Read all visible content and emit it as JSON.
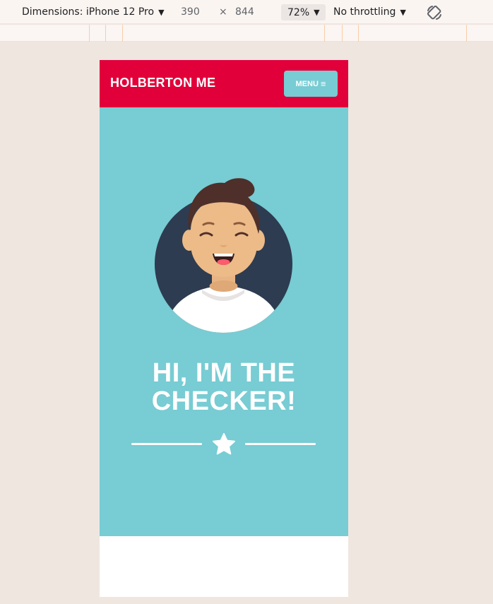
{
  "devtools": {
    "dimensions_label": "Dimensions: iPhone 12 Pro",
    "width": "390",
    "times": "×",
    "height": "844",
    "zoom": "72%",
    "throttling": "No throttling",
    "caret": "▼",
    "rotate_icon": "rotate-icon"
  },
  "site": {
    "brand": "HOLBERTON ME",
    "menu_label": "MENU",
    "menu_icon": "≡",
    "hero_title_line1": "HI, I'M THE",
    "hero_title_line2": "CHECKER!",
    "colors": {
      "header": "#e1003a",
      "hero": "#78ccd3",
      "accent": "#ffffff"
    }
  }
}
